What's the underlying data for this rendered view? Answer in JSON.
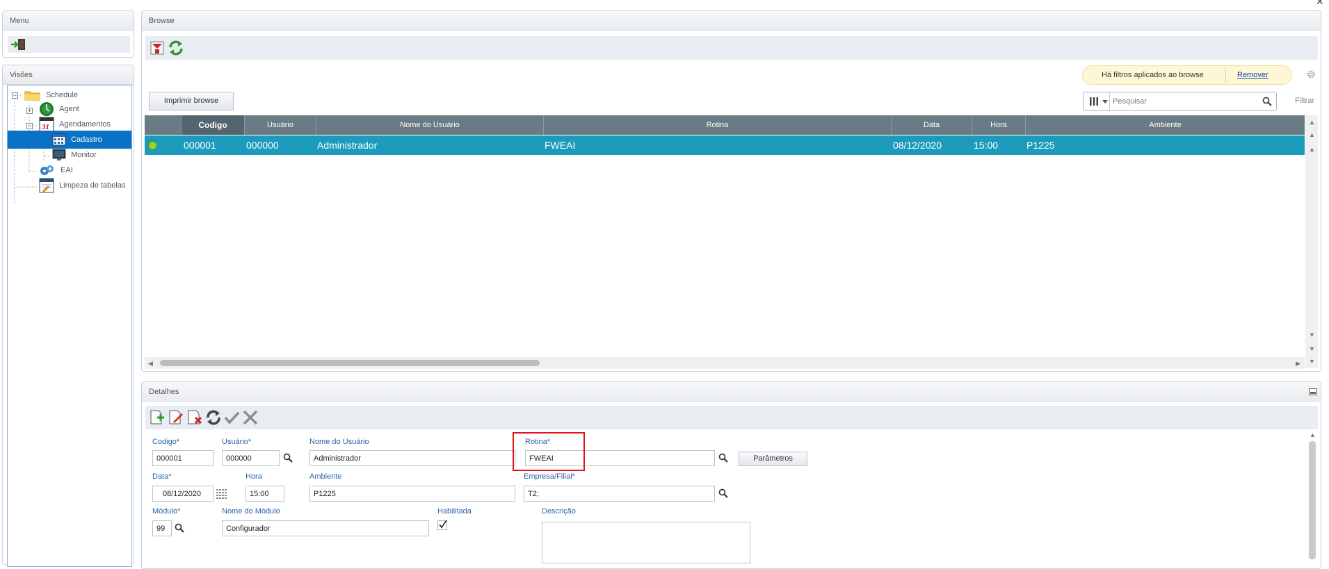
{
  "menu": {
    "title": "Menu",
    "exit_icon": "exit-door-icon"
  },
  "visoes": {
    "title": "Visões",
    "tree": [
      {
        "label": "Schedule",
        "icon": "folder-icon"
      },
      {
        "label": "Agent",
        "icon": "agent-globe-icon"
      },
      {
        "label": "Agendamentos",
        "icon": "calendar-31-icon"
      },
      {
        "label": "Cadastro",
        "icon": "grid-calendar-icon",
        "selected": true
      },
      {
        "label": "Monitor",
        "icon": "monitor-icon"
      },
      {
        "label": "EAI",
        "icon": "puzzle-gear-icon"
      },
      {
        "label": "Limpeza de tabelas",
        "icon": "table-clean-icon"
      }
    ]
  },
  "browse": {
    "title": "Browse",
    "filter_notice": "Há filtros aplicados ao browse",
    "remove_link": "Remover",
    "print_button": "Imprimir browse",
    "search_placeholder": "Pesquisar",
    "filter_label": "Filtrar",
    "columns": [
      "Codigo",
      "Usuário",
      "Nome do Usuário",
      "Rotina",
      "Data",
      "Hora",
      "Ambiente"
    ],
    "rows": [
      {
        "status_color": "#8fd52b",
        "cells": [
          "000001",
          "000000",
          "Administrador",
          "FWEAI",
          "08/12/2020",
          "15:00",
          "P1225"
        ]
      }
    ]
  },
  "details": {
    "title": "Detalhes",
    "labels": {
      "codigo": "Codigo*",
      "usuario": "Usuário*",
      "nome_usuario": "Nome do Usuário",
      "rotina": "Rotina*",
      "data": "Data*",
      "hora": "Hora",
      "ambiente": "Ambiente",
      "empresa": "Empresa/Filial*",
      "modulo": "Módulo*",
      "nome_modulo": "Nome do Módulo",
      "habilitada": "Habilitada",
      "descricao": "Descrição"
    },
    "values": {
      "codigo": "000001",
      "usuario": "000000",
      "nome_usuario": "Administrador",
      "rotina": "FWEAI",
      "data": "08/12/2020",
      "hora": "15:00",
      "ambiente": "P1225",
      "empresa": "T2;",
      "modulo": "99",
      "nome_modulo": "Configurador",
      "habilitada": true,
      "descricao": ""
    },
    "parametros_button": "Parâmetros",
    "highlight_color": "#e0141c"
  }
}
